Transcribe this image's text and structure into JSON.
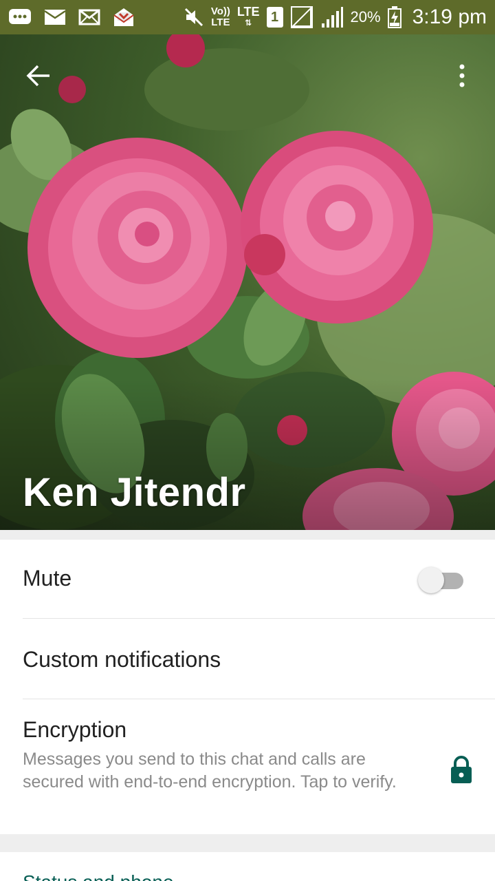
{
  "status_bar": {
    "network_volte": "Vo))",
    "network_lte": "LTE",
    "network_lte2": "LTE",
    "sim_slot": "1",
    "battery_percent": "20%",
    "time": "3:19 pm",
    "background_color": "#5e6b2a"
  },
  "header": {
    "contact_name": "Ken Jitendr",
    "back_icon": "arrow-left-icon",
    "menu_icon": "more-vert-icon"
  },
  "settings": {
    "mute_label": "Mute",
    "mute_enabled": false,
    "custom_notifications_label": "Custom notifications",
    "encryption_label": "Encryption",
    "encryption_description": "Messages you send to this chat and calls are secured with end-to-end encryption. Tap to verify.",
    "encryption_icon": "lock-icon",
    "accent_color": "#075e54"
  },
  "next_section": {
    "title": "Status and phone"
  }
}
